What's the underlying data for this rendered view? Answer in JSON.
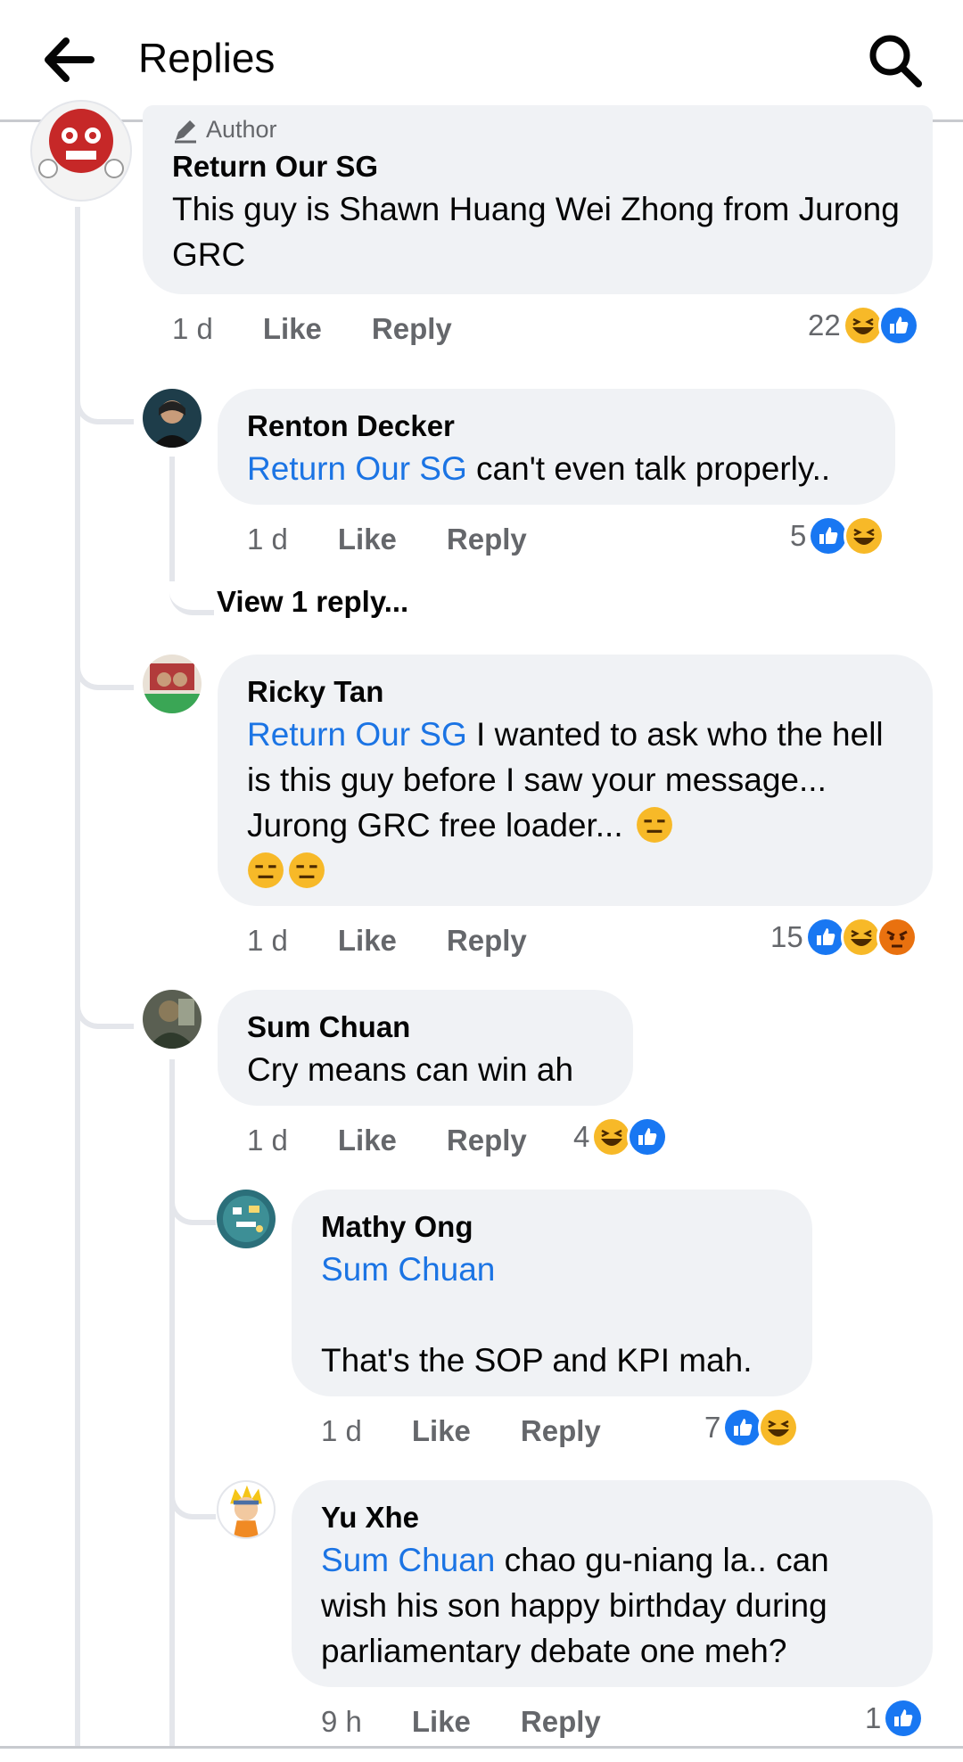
{
  "header": {
    "title": "Replies"
  },
  "comments": [
    {
      "author_tag": "Author",
      "name": "Return Our SG",
      "text": "This guy is Shawn Huang Wei Zhong from Jurong GRC",
      "time": "1 d",
      "like": "Like",
      "reply": "Reply",
      "reaction_count": "22",
      "reactions": [
        "haha-icon",
        "like-icon"
      ]
    },
    {
      "name": "Renton Decker",
      "mention": "Return Our SG",
      "text": " can't even talk properly..",
      "time": "1 d",
      "like": "Like",
      "reply": "Reply",
      "reaction_count": "5",
      "reactions": [
        "like-icon",
        "haha-icon"
      ],
      "view_replies": "View 1 reply..."
    },
    {
      "name": "Ricky Tan",
      "mention": "Return Our SG",
      "text": " I wanted to ask who the hell is this guy before I saw your message... Jurong GRC free loader... ",
      "emojis": [
        "expressionless-face",
        "expressionless-face",
        "expressionless-face"
      ],
      "time": "1 d",
      "like": "Like",
      "reply": "Reply",
      "reaction_count": "15",
      "reactions": [
        "like-icon",
        "haha-icon",
        "angry-icon"
      ]
    },
    {
      "name": "Sum Chuan",
      "text": "Cry means can win ah",
      "time": "1 d",
      "like": "Like",
      "reply": "Reply",
      "reaction_count": "4",
      "reactions": [
        "haha-icon",
        "like-icon"
      ]
    },
    {
      "name": "Mathy Ong",
      "mention": "Sum Chuan",
      "text": "That's the SOP and KPI mah.",
      "time": "1 d",
      "like": "Like",
      "reply": "Reply",
      "reaction_count": "7",
      "reactions": [
        "like-icon",
        "haha-icon"
      ]
    },
    {
      "name": "Yu Xhe",
      "mention": "Sum Chuan",
      "text": " chao gu-niang la.. can wish his son happy birthday during parliamentary debate one meh?",
      "time": "9 h",
      "like": "Like",
      "reply": "Reply",
      "reaction_count": "1",
      "reactions": [
        "like-icon"
      ]
    }
  ],
  "colors": {
    "mention": "#1b74e4",
    "bubble": "#f0f2f5",
    "like": "#1877f2",
    "haha": "#f7b928",
    "angry": "#e9710f"
  }
}
